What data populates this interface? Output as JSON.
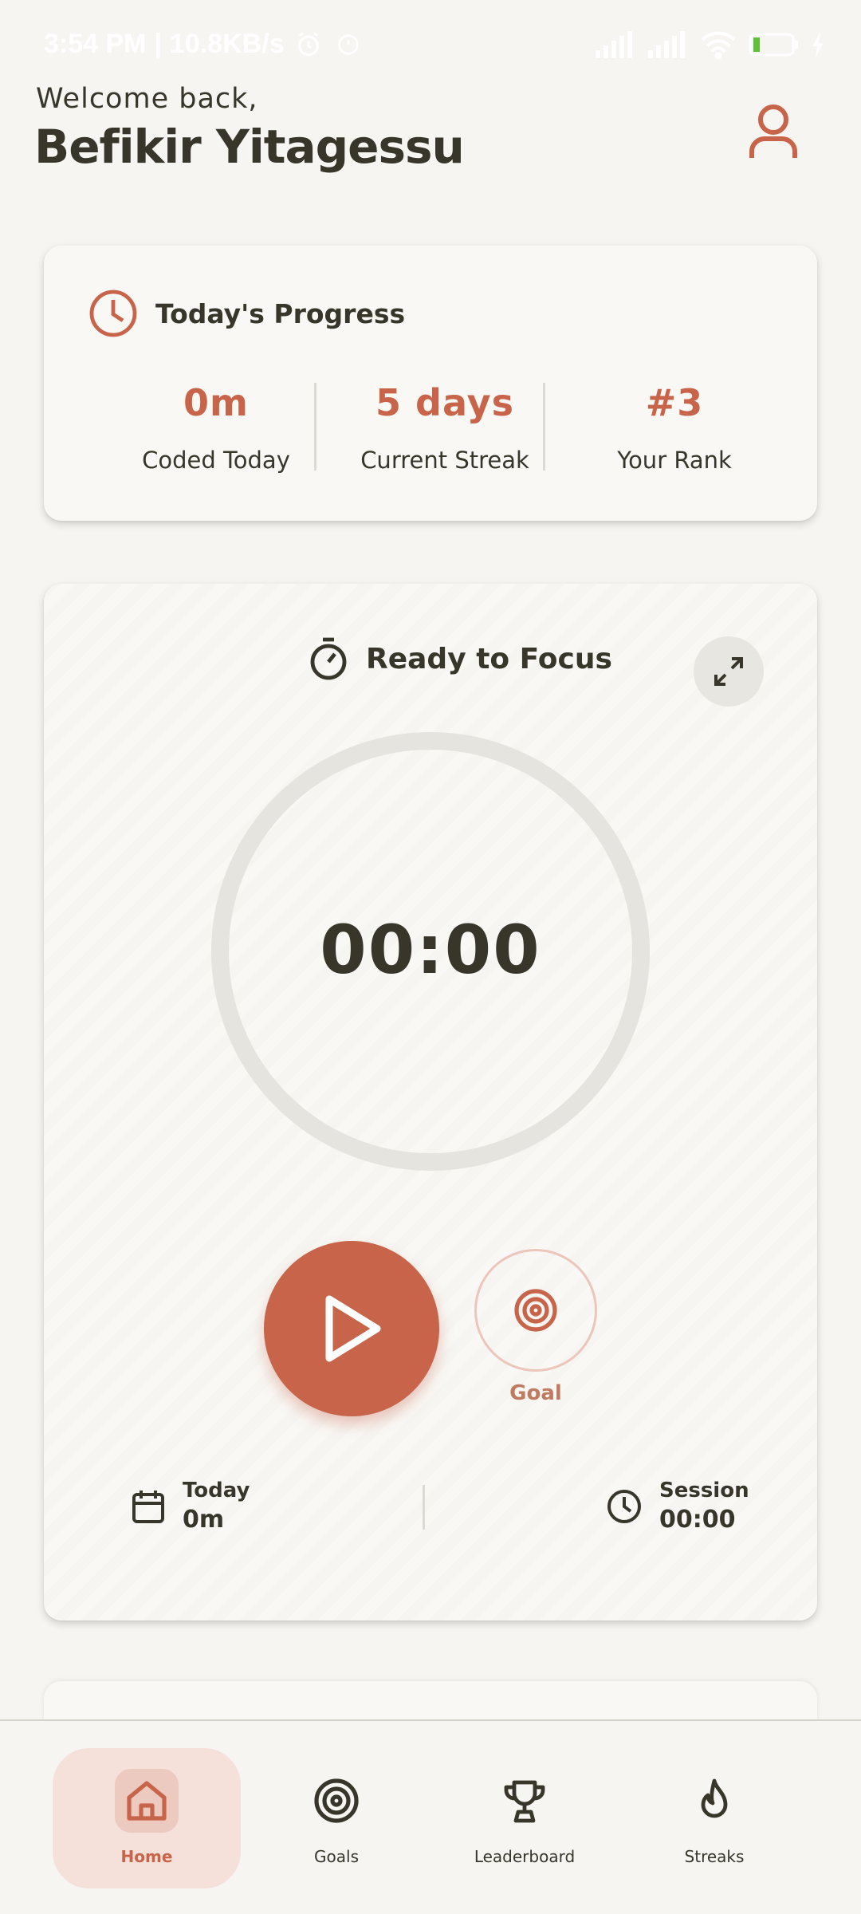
{
  "status_bar": {
    "time": "3:54 PM",
    "speed": "10.8KB/s",
    "battery": "12"
  },
  "header": {
    "welcome": "Welcome back,",
    "username": "Befikir Yitagessu"
  },
  "progress": {
    "title": "Today's Progress",
    "stats": [
      {
        "value": "0m",
        "label": "Coded Today"
      },
      {
        "value": "5 days",
        "label": "Current Streak"
      },
      {
        "value": "#3",
        "label": "Your Rank"
      }
    ]
  },
  "timer": {
    "title": "Ready to Focus",
    "display": "00:00",
    "goal_label": "Goal",
    "today_label": "Today",
    "today_value": "0m",
    "session_label": "Session",
    "session_value": "00:00"
  },
  "nav": {
    "items": [
      {
        "label": "Home",
        "icon": "home-icon",
        "active": true
      },
      {
        "label": "Goals",
        "icon": "target-icon",
        "active": false
      },
      {
        "label": "Leaderboard",
        "icon": "trophy-icon",
        "active": false
      },
      {
        "label": "Streaks",
        "icon": "flame-icon",
        "active": false
      }
    ]
  },
  "colors": {
    "accent": "#c8644a",
    "text": "#38352b",
    "background": "#f7f5f1",
    "card": "#f9f8f5"
  }
}
